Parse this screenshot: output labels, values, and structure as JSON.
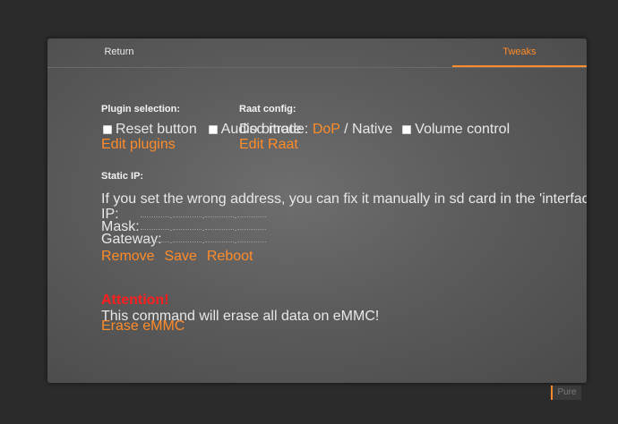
{
  "tabs": {
    "return_label": "Return",
    "tweaks_label": "Tweaks"
  },
  "plugin_selection": {
    "heading": "Plugin selection:",
    "reset_button_label": "Reset button",
    "audio_bitrate_label": "Audio bitrate",
    "edit_link": "Edit plugins"
  },
  "raat_config": {
    "heading": "Raat config:",
    "dsd_mode_label": "Dsd mode:",
    "dop_label": "DoP",
    "separator": "/",
    "native_label": "Native",
    "volume_control_label": "Volume control",
    "edit_link": "Edit Raat"
  },
  "static_ip": {
    "heading": "Static IP:",
    "note": "If you set the wrong address, you can fix it manually in sd card in the 'interfaces' file!",
    "ip_label": "IP:",
    "mask_label": "Mask:",
    "gateway_label": "Gateway:",
    "remove_label": "Remove",
    "save_label": "Save",
    "reboot_label": "Reboot"
  },
  "erase": {
    "attention": "Attention!",
    "message": "This command will erase all data on eMMC!",
    "erase_link": "Erase eMMC"
  },
  "footer": {
    "pure_label": "Pure"
  },
  "colors": {
    "accent": "#ff8c2a",
    "warning": "#ff1e1e",
    "background": "#2b2b2b"
  }
}
